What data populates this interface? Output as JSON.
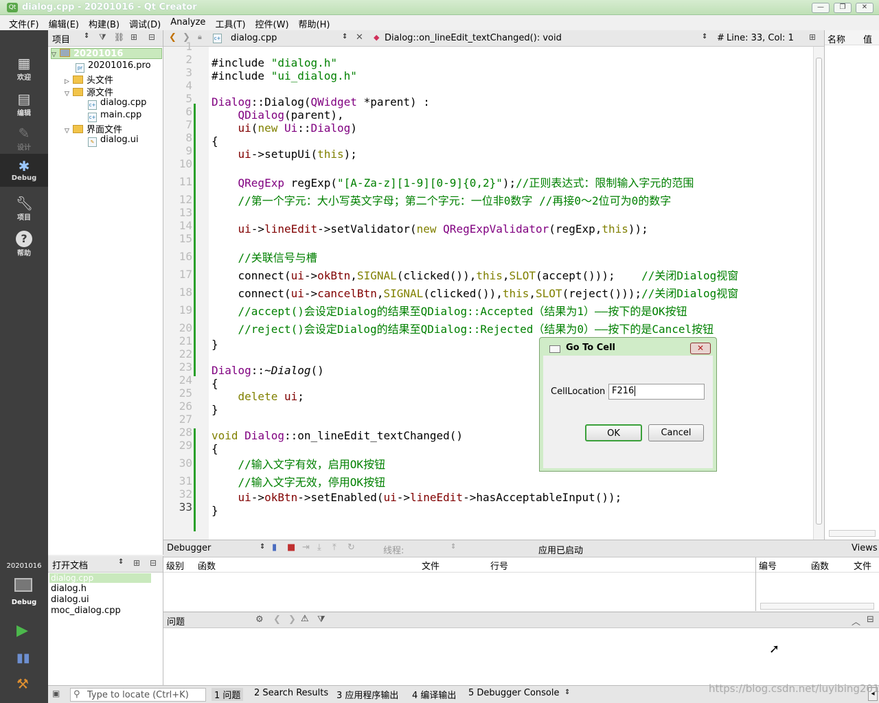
{
  "window": {
    "title": "dialog.cpp - 20201016 - Qt Creator"
  },
  "menu": [
    "文件(F)",
    "编辑(E)",
    "构建(B)",
    "调试(D)",
    "Analyze",
    "工具(T)",
    "控件(W)",
    "帮助(H)"
  ],
  "modes": [
    {
      "label": "欢迎",
      "icon": "grid-icon"
    },
    {
      "label": "编辑",
      "icon": "document-icon"
    },
    {
      "label": "设计",
      "icon": "pencil-icon"
    },
    {
      "label": "Debug",
      "icon": "bug-icon"
    },
    {
      "label": "项目",
      "icon": "wrench-icon"
    },
    {
      "label": "帮助",
      "icon": "help-icon"
    }
  ],
  "kit": {
    "project": "20201016",
    "mode": "Debug"
  },
  "project_pane": {
    "title": "项目",
    "root": "20201016",
    "pro_file": "20201016.pro",
    "headers": "头文件",
    "sources": "源文件",
    "source_files": [
      "dialog.cpp",
      "main.cpp"
    ],
    "forms": "界面文件",
    "form_files": [
      "dialog.ui"
    ]
  },
  "open_docs": {
    "title": "打开文档",
    "files": [
      "dialog.cpp",
      "dialog.h",
      "dialog.ui",
      "moc_dialog.cpp"
    ]
  },
  "editor": {
    "file": "dialog.cpp",
    "symbol": "Dialog::on_lineEdit_textChanged(): void",
    "hash": "#",
    "position": "Line: 33, Col: 1",
    "current_line": "33"
  },
  "right_pane": {
    "col1": "名称",
    "col2": "值"
  },
  "debugger": {
    "selector": "Debugger",
    "thread": "线程:",
    "status": "应用已启动",
    "views": "Views",
    "stack_cols": [
      "级别",
      "函数",
      "文件",
      "行号"
    ],
    "bp_cols": [
      "编号",
      "函数",
      "文件"
    ]
  },
  "issues": {
    "title": "问题"
  },
  "statusbar": {
    "locate_placeholder": "Type to locate (Ctrl+K)",
    "tabs": [
      "1 问题",
      "2 Search Results",
      "3 应用程序输出",
      "4 编译输出",
      "5 Debugger Console"
    ]
  },
  "dialog": {
    "title": "Go To Cell",
    "label": "CellLocation",
    "value": "F216",
    "ok": "OK",
    "cancel": "Cancel"
  },
  "watermark": "https://blog.csdn.net/luyibing201",
  "colors": {
    "accent": "#2aa02a",
    "titlebar": "#c7e6bf",
    "sidebar": "#3e3e3e"
  }
}
